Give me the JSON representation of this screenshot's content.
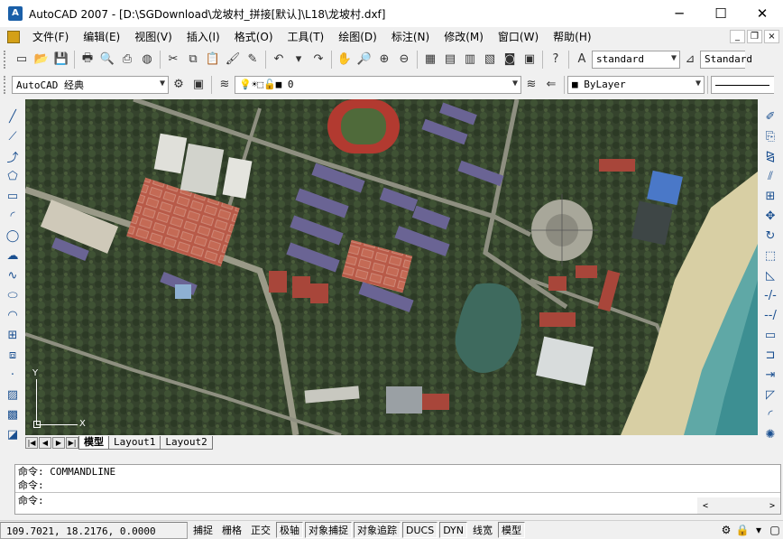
{
  "window": {
    "title": "AutoCAD 2007 - [D:\\SGDownload\\龙坡村_拼接[默认]\\L18\\龙坡村.dxf]",
    "icon": "autocad-icon",
    "controls": {
      "minimize": "─",
      "maximize": "☐",
      "close": "✕"
    }
  },
  "menubar": {
    "items": [
      "文件(F)",
      "编辑(E)",
      "视图(V)",
      "插入(I)",
      "格式(O)",
      "工具(T)",
      "绘图(D)",
      "标注(N)",
      "修改(M)",
      "窗口(W)",
      "帮助(H)"
    ],
    "mdi_controls": {
      "minimize": "_",
      "restore": "❐",
      "close": "×"
    }
  },
  "standard_toolbar": {
    "text_style": "standard",
    "dim_style": "Standard"
  },
  "workspace_toolbar": {
    "workspace": "AutoCAD 经典",
    "layer": "0",
    "color": "ByLayer"
  },
  "layout_tabs": [
    "模型",
    "Layout1",
    "Layout2"
  ],
  "active_tab": "模型",
  "ucs": {
    "x_label": "X",
    "y_label": "Y"
  },
  "command": {
    "history": [
      "命令: COMMANDLINE",
      "命令:"
    ],
    "prompt": "命令:"
  },
  "statusbar": {
    "coordinates": "109.7021, 18.2176, 0.0000",
    "toggles": [
      "捕捉",
      "栅格",
      "正交",
      "极轴",
      "对象捕捉",
      "对象追踪",
      "DUCS",
      "DYN",
      "线宽",
      "模型"
    ]
  },
  "colors": {
    "title_bg": "#ffffff",
    "chrome": "#f0f0f0",
    "accent": "#1a5fa8"
  }
}
